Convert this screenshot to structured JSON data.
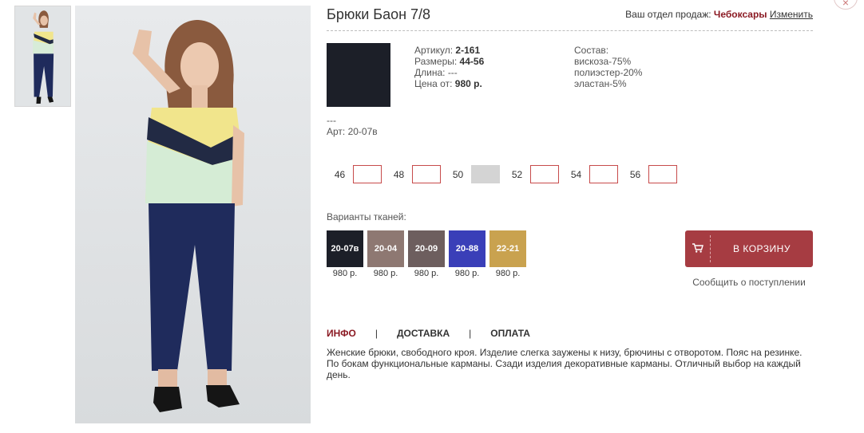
{
  "product": {
    "title": "Брюки Баон 7/8",
    "article_label": "Артикул:",
    "article_value": "2-161",
    "sizes_label": "Размеры:",
    "sizes_value": "44-56",
    "length_label": "Длина:",
    "length_value": "---",
    "price_label": "Цена от:",
    "price_value": "980 р.",
    "composition_label": "Состав:",
    "composition": [
      "вискоза-75%",
      "полиэстер-20%",
      "эластан-5%"
    ],
    "art_dash": "---",
    "art_code": "Арт: 20-07в",
    "main_swatch_color": "#1c1f28"
  },
  "header": {
    "dept_label": "Ваш отдел продаж:",
    "dept_city": "Чебоксары",
    "dept_change": "Изменить",
    "close_icon": "×"
  },
  "sizes": [
    {
      "label": "46",
      "value": "",
      "disabled": false
    },
    {
      "label": "48",
      "value": "",
      "disabled": false
    },
    {
      "label": "50",
      "value": "",
      "disabled": true
    },
    {
      "label": "52",
      "value": "",
      "disabled": false
    },
    {
      "label": "54",
      "value": "",
      "disabled": false
    },
    {
      "label": "56",
      "value": "",
      "disabled": false
    }
  ],
  "variants_label": "Варианты тканей:",
  "variants": [
    {
      "code": "20-07в",
      "price": "980 р.",
      "color": "#1c1f28"
    },
    {
      "code": "20-04",
      "price": "980 р.",
      "color": "#8e7872"
    },
    {
      "code": "20-09",
      "price": "980 р.",
      "color": "#6d5e5e"
    },
    {
      "code": "20-88",
      "price": "980 р.",
      "color": "#3a3fb8"
    },
    {
      "code": "22-21",
      "price": "980 р.",
      "color": "#c9a24f"
    }
  ],
  "cart": {
    "label": "В КОРЗИНУ",
    "icon": "cart-icon",
    "notify": "Сообщить о поступлении"
  },
  "tabs": [
    {
      "label": "ИНФО",
      "active": true
    },
    {
      "label": "ДОСТАВКА",
      "active": false
    },
    {
      "label": "ОПЛАТА",
      "active": false
    }
  ],
  "tab_separator": "|",
  "description": "Женские брюки, свободного кроя. Изделие слегка заужены к низу, брючины с отворотом. Пояс на резинке. По бокам функциональные карманы. Сзади изделия декоративные карманы. Отличный выбор на каждый день.",
  "colors": {
    "accent": "#8b1a23",
    "cart_button": "#a63c42"
  }
}
